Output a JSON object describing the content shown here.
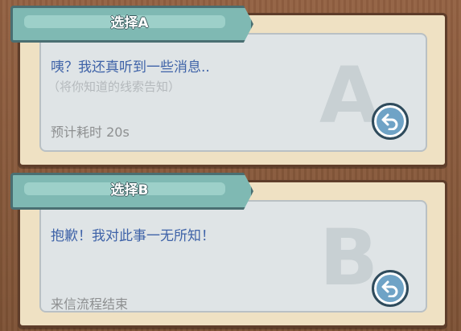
{
  "choices": [
    {
      "tab_label": "选择A",
      "letter": "A",
      "main_text": "咦？我还真听到一些消息..",
      "hint_text": "（将你知道的线索告知）",
      "footer_text": "预计耗时 20s",
      "button_icon": "return-arrow-icon"
    },
    {
      "tab_label": "选择B",
      "letter": "B",
      "main_text": "抱歉！我对此事一无所知！",
      "footer_text": "来信流程结束",
      "button_icon": "return-arrow-icon"
    }
  ],
  "colors": {
    "tab": "#7fb9b3",
    "main_text": "#3f63a8",
    "button": "#6fa3c6"
  }
}
